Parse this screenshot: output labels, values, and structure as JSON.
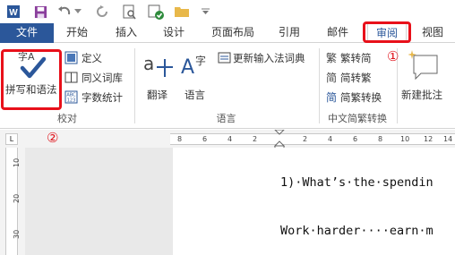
{
  "qat": {
    "icons": [
      "word-icon",
      "save-icon",
      "undo-icon",
      "undo-dropdown-icon",
      "redo-icon",
      "print-preview-icon",
      "spelling-icon",
      "open-folder-icon",
      "customize-dropdown-icon"
    ]
  },
  "tabs": [
    {
      "label": "文件"
    },
    {
      "label": "开始"
    },
    {
      "label": "插入"
    },
    {
      "label": "设计"
    },
    {
      "label": "页面布局"
    },
    {
      "label": "引用"
    },
    {
      "label": "邮件"
    },
    {
      "label": "审阅"
    },
    {
      "label": "视图"
    }
  ],
  "ribbon": {
    "proofing": {
      "spelling_label": "拼写和语法",
      "define_label": "定义",
      "thesaurus_label": "同义词库",
      "wordcount_label": "字数统计",
      "group_label": "校对"
    },
    "language": {
      "translate_label": "翻译",
      "language_label": "语言",
      "update_ime_label": "更新输入法词典",
      "group_label": "语言"
    },
    "chinese": {
      "to_trad_label": "繁转简",
      "to_simp_label": "简转繁",
      "convert_label": "简繁转换",
      "group_label": "中文简繁转换"
    },
    "comments": {
      "new_comment_label": "新建批注"
    }
  },
  "callouts": {
    "one": "①",
    "two": "②"
  },
  "ruler": {
    "corner_label": "L",
    "ticks": [
      "8",
      "6",
      "4",
      "2",
      "2",
      "4",
      "6",
      "8",
      "10",
      "12",
      "14"
    ],
    "vticks": [
      "10",
      "20",
      "30"
    ]
  },
  "document": {
    "line1": "1)·What’s·the·spendin",
    "line2": "Work·harder····earn·m"
  },
  "colors": {
    "file_tab": "#2b579a",
    "highlight": "#e8101a",
    "check_icon": "#2b579a"
  }
}
